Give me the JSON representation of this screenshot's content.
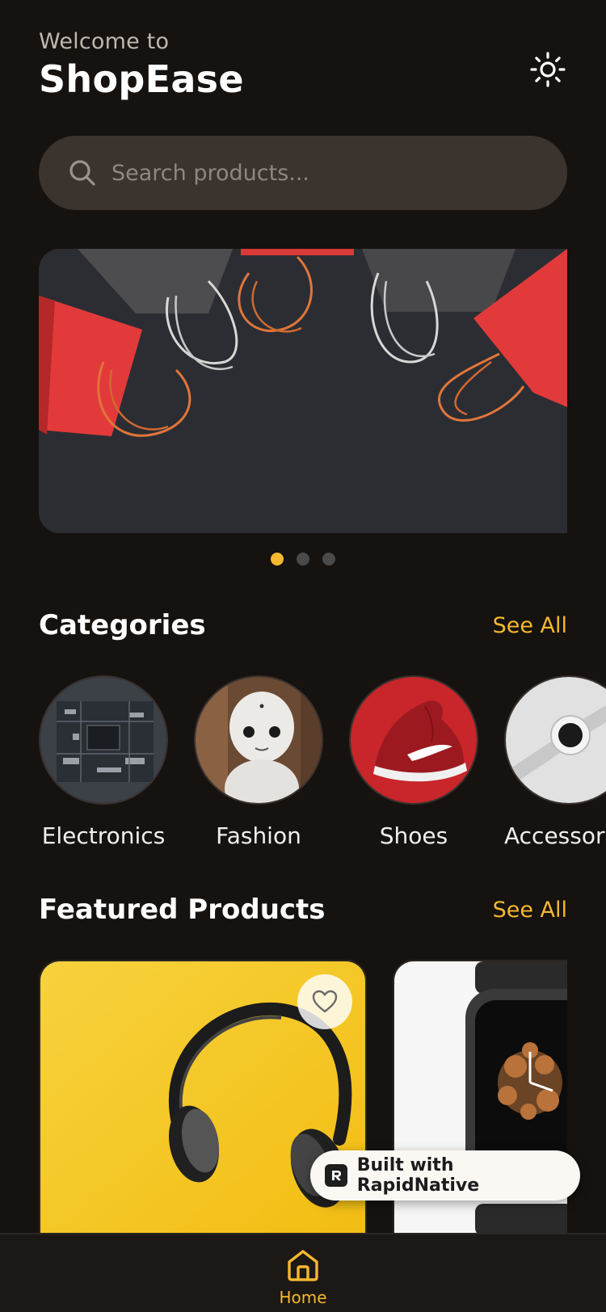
{
  "header": {
    "welcome": "Welcome to",
    "brand": "ShopEase",
    "theme_icon": "sun-icon"
  },
  "search": {
    "placeholder": "Search products...",
    "icon": "search-icon"
  },
  "carousel": {
    "slide_count": 3,
    "active_index": 0
  },
  "categories": {
    "title": "Categories",
    "see_all": "See All",
    "items": [
      {
        "label": "Electronics"
      },
      {
        "label": "Fashion"
      },
      {
        "label": "Shoes"
      },
      {
        "label": "Accessories"
      }
    ]
  },
  "featured": {
    "title": "Featured Products",
    "see_all": "See All",
    "favorite_icon": "heart-icon"
  },
  "badge": {
    "text": "Built with RapidNative"
  },
  "tabbar": {
    "items": [
      {
        "label": "Home",
        "icon": "home-icon",
        "active": true
      }
    ]
  },
  "colors": {
    "background": "#151210",
    "accent": "#f5b82e",
    "search_bg": "#3b342e"
  }
}
